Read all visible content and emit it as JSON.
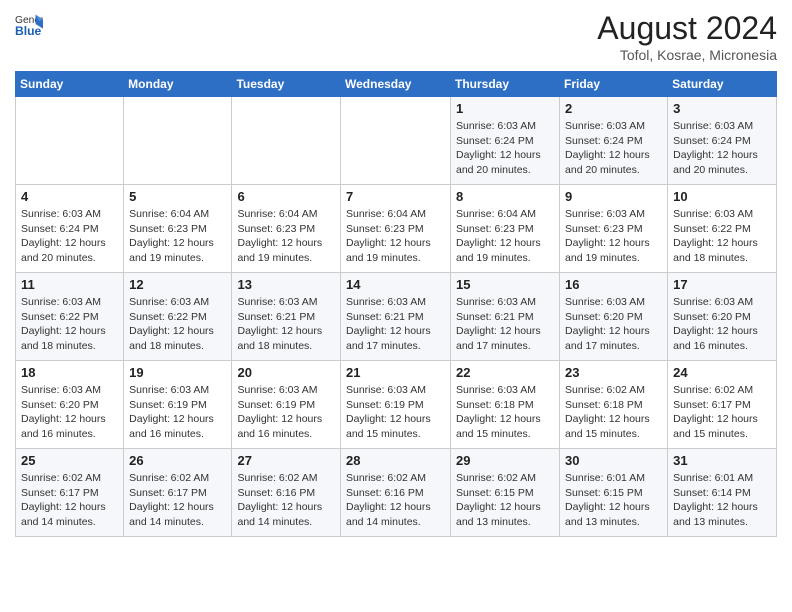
{
  "header": {
    "logo_line1": "General",
    "logo_line2": "Blue",
    "month_year": "August 2024",
    "location": "Tofol, Kosrae, Micronesia"
  },
  "days_of_week": [
    "Sunday",
    "Monday",
    "Tuesday",
    "Wednesday",
    "Thursday",
    "Friday",
    "Saturday"
  ],
  "weeks": [
    [
      {
        "day": "",
        "sunrise": "",
        "sunset": "",
        "daylight": ""
      },
      {
        "day": "",
        "sunrise": "",
        "sunset": "",
        "daylight": ""
      },
      {
        "day": "",
        "sunrise": "",
        "sunset": "",
        "daylight": ""
      },
      {
        "day": "",
        "sunrise": "",
        "sunset": "",
        "daylight": ""
      },
      {
        "day": "1",
        "sunrise": "Sunrise: 6:03 AM",
        "sunset": "Sunset: 6:24 PM",
        "daylight": "Daylight: 12 hours and 20 minutes."
      },
      {
        "day": "2",
        "sunrise": "Sunrise: 6:03 AM",
        "sunset": "Sunset: 6:24 PM",
        "daylight": "Daylight: 12 hours and 20 minutes."
      },
      {
        "day": "3",
        "sunrise": "Sunrise: 6:03 AM",
        "sunset": "Sunset: 6:24 PM",
        "daylight": "Daylight: 12 hours and 20 minutes."
      }
    ],
    [
      {
        "day": "4",
        "sunrise": "Sunrise: 6:03 AM",
        "sunset": "Sunset: 6:24 PM",
        "daylight": "Daylight: 12 hours and 20 minutes."
      },
      {
        "day": "5",
        "sunrise": "Sunrise: 6:04 AM",
        "sunset": "Sunset: 6:23 PM",
        "daylight": "Daylight: 12 hours and 19 minutes."
      },
      {
        "day": "6",
        "sunrise": "Sunrise: 6:04 AM",
        "sunset": "Sunset: 6:23 PM",
        "daylight": "Daylight: 12 hours and 19 minutes."
      },
      {
        "day": "7",
        "sunrise": "Sunrise: 6:04 AM",
        "sunset": "Sunset: 6:23 PM",
        "daylight": "Daylight: 12 hours and 19 minutes."
      },
      {
        "day": "8",
        "sunrise": "Sunrise: 6:04 AM",
        "sunset": "Sunset: 6:23 PM",
        "daylight": "Daylight: 12 hours and 19 minutes."
      },
      {
        "day": "9",
        "sunrise": "Sunrise: 6:03 AM",
        "sunset": "Sunset: 6:23 PM",
        "daylight": "Daylight: 12 hours and 19 minutes."
      },
      {
        "day": "10",
        "sunrise": "Sunrise: 6:03 AM",
        "sunset": "Sunset: 6:22 PM",
        "daylight": "Daylight: 12 hours and 18 minutes."
      }
    ],
    [
      {
        "day": "11",
        "sunrise": "Sunrise: 6:03 AM",
        "sunset": "Sunset: 6:22 PM",
        "daylight": "Daylight: 12 hours and 18 minutes."
      },
      {
        "day": "12",
        "sunrise": "Sunrise: 6:03 AM",
        "sunset": "Sunset: 6:22 PM",
        "daylight": "Daylight: 12 hours and 18 minutes."
      },
      {
        "day": "13",
        "sunrise": "Sunrise: 6:03 AM",
        "sunset": "Sunset: 6:21 PM",
        "daylight": "Daylight: 12 hours and 18 minutes."
      },
      {
        "day": "14",
        "sunrise": "Sunrise: 6:03 AM",
        "sunset": "Sunset: 6:21 PM",
        "daylight": "Daylight: 12 hours and 17 minutes."
      },
      {
        "day": "15",
        "sunrise": "Sunrise: 6:03 AM",
        "sunset": "Sunset: 6:21 PM",
        "daylight": "Daylight: 12 hours and 17 minutes."
      },
      {
        "day": "16",
        "sunrise": "Sunrise: 6:03 AM",
        "sunset": "Sunset: 6:20 PM",
        "daylight": "Daylight: 12 hours and 17 minutes."
      },
      {
        "day": "17",
        "sunrise": "Sunrise: 6:03 AM",
        "sunset": "Sunset: 6:20 PM",
        "daylight": "Daylight: 12 hours and 16 minutes."
      }
    ],
    [
      {
        "day": "18",
        "sunrise": "Sunrise: 6:03 AM",
        "sunset": "Sunset: 6:20 PM",
        "daylight": "Daylight: 12 hours and 16 minutes."
      },
      {
        "day": "19",
        "sunrise": "Sunrise: 6:03 AM",
        "sunset": "Sunset: 6:19 PM",
        "daylight": "Daylight: 12 hours and 16 minutes."
      },
      {
        "day": "20",
        "sunrise": "Sunrise: 6:03 AM",
        "sunset": "Sunset: 6:19 PM",
        "daylight": "Daylight: 12 hours and 16 minutes."
      },
      {
        "day": "21",
        "sunrise": "Sunrise: 6:03 AM",
        "sunset": "Sunset: 6:19 PM",
        "daylight": "Daylight: 12 hours and 15 minutes."
      },
      {
        "day": "22",
        "sunrise": "Sunrise: 6:03 AM",
        "sunset": "Sunset: 6:18 PM",
        "daylight": "Daylight: 12 hours and 15 minutes."
      },
      {
        "day": "23",
        "sunrise": "Sunrise: 6:02 AM",
        "sunset": "Sunset: 6:18 PM",
        "daylight": "Daylight: 12 hours and 15 minutes."
      },
      {
        "day": "24",
        "sunrise": "Sunrise: 6:02 AM",
        "sunset": "Sunset: 6:17 PM",
        "daylight": "Daylight: 12 hours and 15 minutes."
      }
    ],
    [
      {
        "day": "25",
        "sunrise": "Sunrise: 6:02 AM",
        "sunset": "Sunset: 6:17 PM",
        "daylight": "Daylight: 12 hours and 14 minutes."
      },
      {
        "day": "26",
        "sunrise": "Sunrise: 6:02 AM",
        "sunset": "Sunset: 6:17 PM",
        "daylight": "Daylight: 12 hours and 14 minutes."
      },
      {
        "day": "27",
        "sunrise": "Sunrise: 6:02 AM",
        "sunset": "Sunset: 6:16 PM",
        "daylight": "Daylight: 12 hours and 14 minutes."
      },
      {
        "day": "28",
        "sunrise": "Sunrise: 6:02 AM",
        "sunset": "Sunset: 6:16 PM",
        "daylight": "Daylight: 12 hours and 14 minutes."
      },
      {
        "day": "29",
        "sunrise": "Sunrise: 6:02 AM",
        "sunset": "Sunset: 6:15 PM",
        "daylight": "Daylight: 12 hours and 13 minutes."
      },
      {
        "day": "30",
        "sunrise": "Sunrise: 6:01 AM",
        "sunset": "Sunset: 6:15 PM",
        "daylight": "Daylight: 12 hours and 13 minutes."
      },
      {
        "day": "31",
        "sunrise": "Sunrise: 6:01 AM",
        "sunset": "Sunset: 6:14 PM",
        "daylight": "Daylight: 12 hours and 13 minutes."
      }
    ]
  ]
}
